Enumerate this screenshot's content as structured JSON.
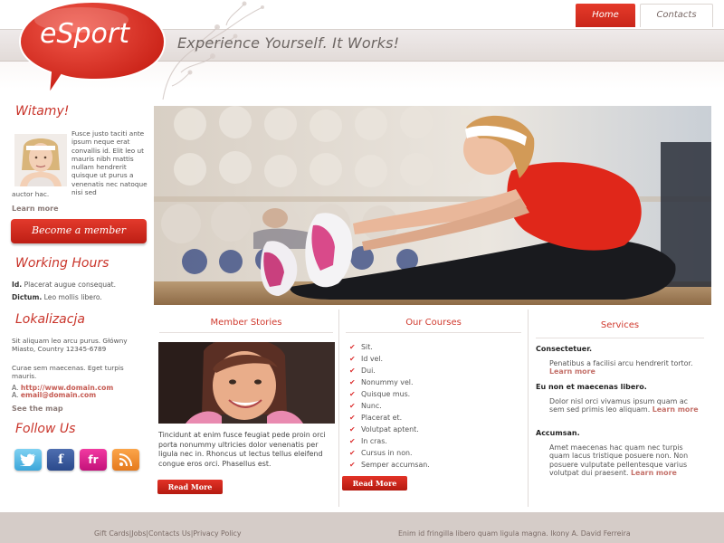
{
  "header": {
    "logo_text": "eSport",
    "tagline": "Experience Yourself. It Works!",
    "nav": [
      {
        "label": "Home",
        "active": true
      },
      {
        "label": "Contacts",
        "active": false
      }
    ],
    "accent_color": "#d52b22"
  },
  "sidebar": {
    "welcome": {
      "heading": "Witamy!",
      "text": "Fusce justo taciti ante ipsum neque erat convallis id. Elit leo ut mauris nibh mattis nullam hendrerit quisque ut purus a venenatis nec natoque nisi sed",
      "text_tail": "auctor hac.",
      "more_label": "Learn more",
      "cta_label": "Become a member"
    },
    "hours": {
      "heading": "Working Hours",
      "line1_bold": "Id.",
      "line1_text": "Placerat augue consequat.",
      "line2_bold": "Dictum.",
      "line2_text": "Leo mollis libero."
    },
    "location": {
      "heading": "Lokalizacja",
      "address": "Sit aliquam leo arcu purus. Główny Miasto, Country 12345-6789",
      "note": "Curae sem maecenas. Eget turpis mauris.",
      "url_prefix": "A.",
      "url": "http://www.domain.com",
      "email_prefix": "A.",
      "email": "email@domain.com",
      "map_label": "See the map"
    },
    "follow": {
      "heading": "Follow Us",
      "icons": [
        "twitter-icon",
        "facebook-icon",
        "friendfeed-icon",
        "rss-icon"
      ]
    }
  },
  "columns": {
    "stories": {
      "title": "Member Stories",
      "text": "Tincidunt at enim fusce feugiat pede proin orci porta nonummy ultricies dolor venenatis per ligula nec in. Rhoncus ut lectus tellus eleifend congue eros orci. Phasellus est.",
      "button": "Read More"
    },
    "courses": {
      "title": "Our Courses",
      "items": [
        "Sit.",
        "Id vel.",
        "Dui.",
        "Nonummy vel.",
        "Quisque mus.",
        "Nunc.",
        "Placerat et.",
        "Volutpat aptent.",
        "In cras.",
        "Cursus in non.",
        "Semper accumsan."
      ],
      "button": "Read More"
    },
    "services": {
      "title": "Services",
      "items": [
        {
          "heading": "Consectetuer.",
          "text": "Penatibus a facilisi arcu hendrerit tortor.",
          "more": "Learn more"
        },
        {
          "heading": "Eu non et maecenas libero.",
          "text": "Dolor nisl orci vivamus ipsum quam ac sem sed primis leo aliquam.",
          "more": "Learn more"
        },
        {
          "heading": "Accumsan.",
          "text": "Amet maecenas hac quam nec turpis quam lacus tristique posuere non. Non posuere vulputate pellentesque varius volutpat dui praesent.",
          "more": "Learn more"
        }
      ]
    }
  },
  "footer": {
    "links": [
      "Gift Cards",
      "Jobs",
      "Contacts Us",
      "Privacy Policy"
    ],
    "separator": "|",
    "copyright": "Enim id fringilla libero quam ligula magna. Ikony A. David Ferreira"
  }
}
